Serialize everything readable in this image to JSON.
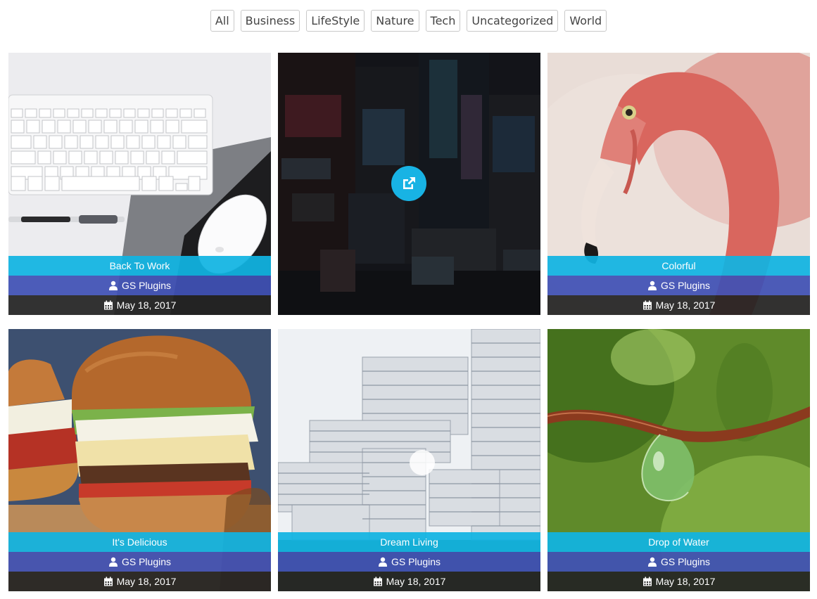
{
  "filters": [
    "All",
    "Business",
    "LifeStyle",
    "Nature",
    "Tech",
    "Uncategorized",
    "World"
  ],
  "colors": {
    "title_bar": "#10b4e2",
    "author_bar": "#3f51b5",
    "date_bar": "#242424",
    "link_button": "#18b3e4"
  },
  "icons": {
    "author": "user-icon",
    "date": "calendar-icon",
    "hover_link": "external-link-icon"
  },
  "posts": [
    {
      "title": "Back To Work",
      "author": "GS Plugins",
      "date": "May 18, 2017",
      "image": "keyboard-mouse-desk-photo"
    },
    {
      "title": "",
      "author": "",
      "date": "",
      "image": "city-billboards-night-photo",
      "hovered": true
    },
    {
      "title": "Colorful",
      "author": "GS Plugins",
      "date": "May 18, 2017",
      "image": "flamingo-photo"
    },
    {
      "title": "It's Delicious",
      "author": "GS Plugins",
      "date": "May 18, 2017",
      "image": "burger-photo"
    },
    {
      "title": "Dream Living",
      "author": "GS Plugins",
      "date": "May 18, 2017",
      "image": "apartment-buildings-photo"
    },
    {
      "title": "Drop of Water",
      "author": "GS Plugins",
      "date": "May 18, 2017",
      "image": "water-drop-photo"
    }
  ]
}
